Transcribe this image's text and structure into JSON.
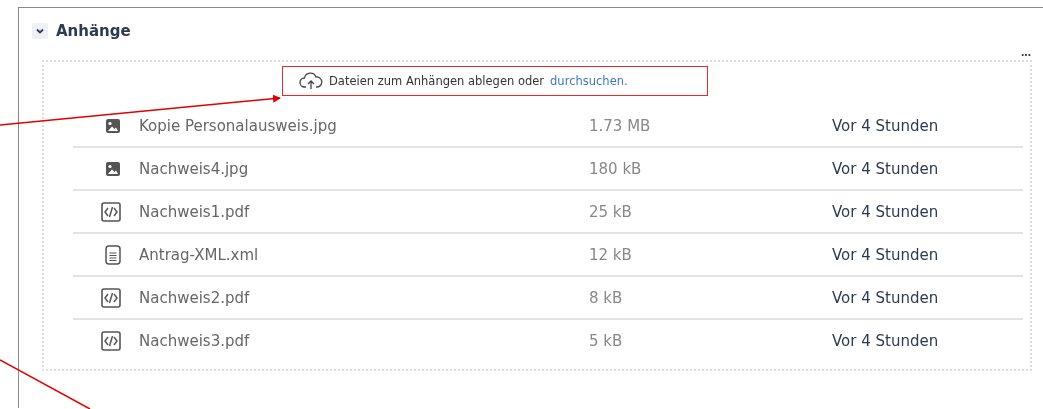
{
  "section": {
    "title": "Anhänge",
    "expanded": true
  },
  "more_menu": "...",
  "dropzone": {
    "text": "Dateien zum Anhängen ablegen oder",
    "link": "durchsuchen."
  },
  "files": [
    {
      "kind": "image",
      "name": "Kopie Personalausweis.jpg",
      "size": "1.73 MB",
      "modified": "Vor 4 Stunden"
    },
    {
      "kind": "image",
      "name": "Nachweis4.jpg",
      "size": "180 kB",
      "modified": "Vor 4 Stunden"
    },
    {
      "kind": "code",
      "name": "Nachweis1.pdf",
      "size": "25 kB",
      "modified": "Vor 4 Stunden"
    },
    {
      "kind": "document",
      "name": "Antrag-XML.xml",
      "size": "12 kB",
      "modified": "Vor 4 Stunden"
    },
    {
      "kind": "code",
      "name": "Nachweis2.pdf",
      "size": "8 kB",
      "modified": "Vor 4 Stunden"
    },
    {
      "kind": "code",
      "name": "Nachweis3.pdf",
      "size": "5 kB",
      "modified": "Vor 4 Stunden"
    }
  ]
}
